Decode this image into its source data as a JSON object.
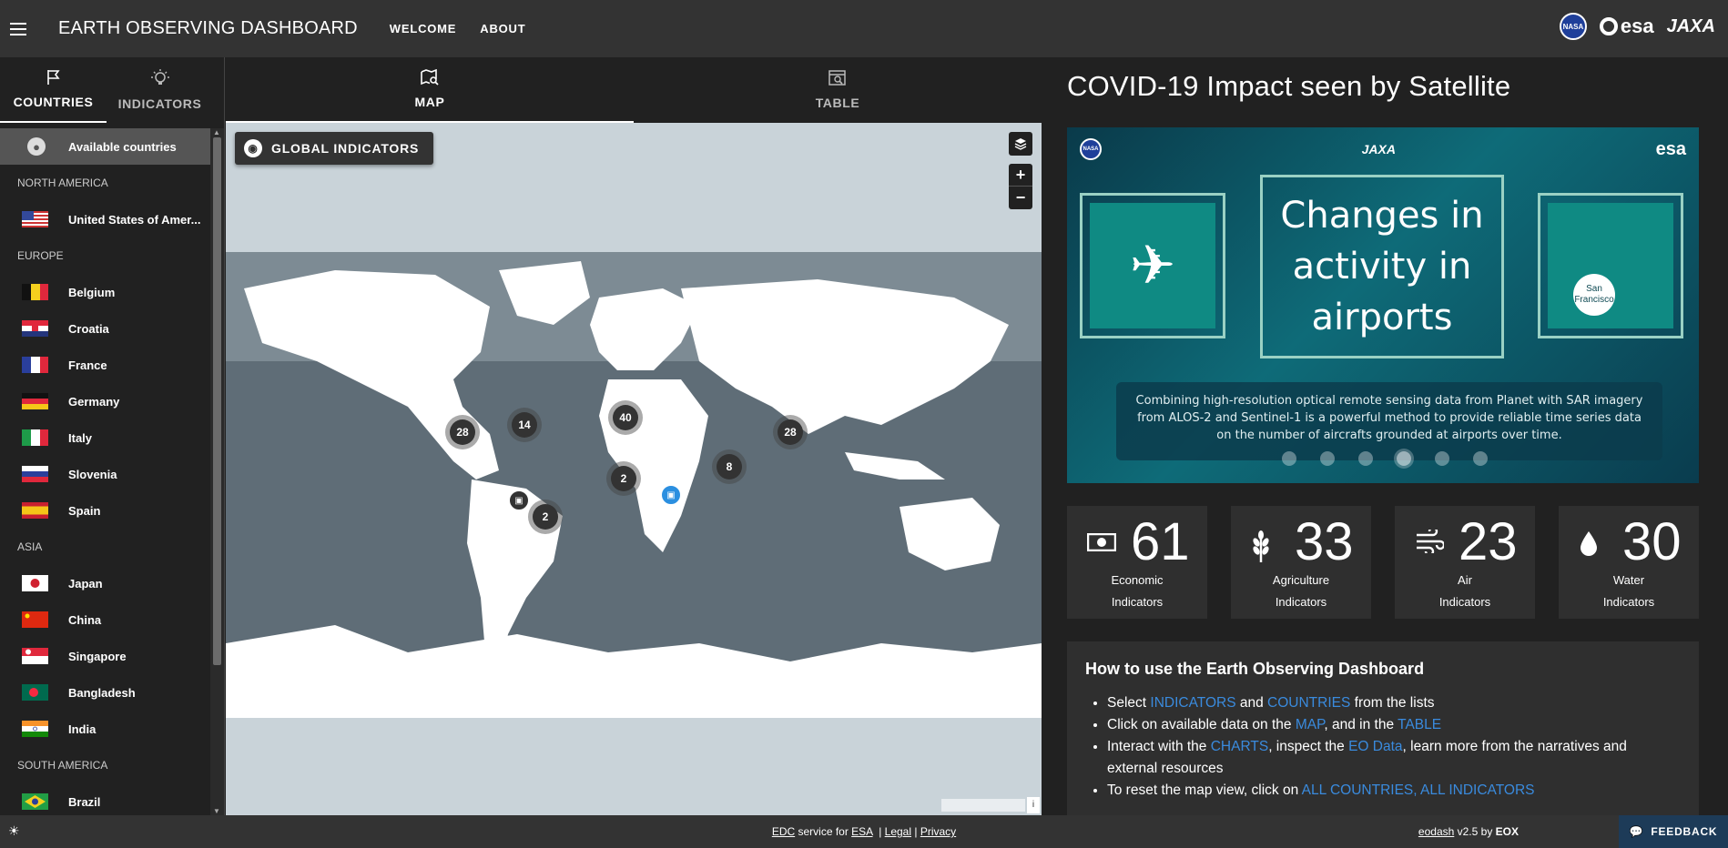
{
  "app": {
    "title": "EARTH OBSERVING DASHBOARD"
  },
  "topnav": [
    "WELCOME",
    "ABOUT"
  ],
  "logos": {
    "nasa": "NASA",
    "esa": "esa",
    "jaxa": "JAXA"
  },
  "sidebar": {
    "tabs": [
      {
        "label": "COUNTRIES",
        "icon": "flag-icon",
        "active": true
      },
      {
        "label": "INDICATORS",
        "icon": "lightbulb-icon",
        "active": false
      }
    ],
    "available": "Available countries",
    "regions": {
      "north_america": "NORTH AMERICA",
      "europe": "EUROPE",
      "asia": "ASIA",
      "south_america": "SOUTH AMERICA"
    },
    "countries": {
      "usa": "United States of Amer...",
      "belgium": "Belgium",
      "croatia": "Croatia",
      "france": "France",
      "germany": "Germany",
      "italy": "Italy",
      "slovenia": "Slovenia",
      "spain": "Spain",
      "japan": "Japan",
      "china": "China",
      "singapore": "Singapore",
      "bangladesh": "Bangladesh",
      "india": "India",
      "brazil": "Brazil"
    }
  },
  "center": {
    "tabs": [
      {
        "label": "MAP",
        "icon": "map-search-icon",
        "active": true
      },
      {
        "label": "TABLE",
        "icon": "table-search-icon",
        "active": false
      }
    ],
    "global_button": "GLOBAL INDICATORS",
    "zoom_in": "+",
    "zoom_out": "−",
    "info": "i",
    "clusters": [
      "28",
      "14",
      "40",
      "2",
      "8",
      "28",
      "2"
    ]
  },
  "right": {
    "title": "COVID-19 Impact seen by Satellite",
    "banner": {
      "headline": [
        "Changes in",
        "activity in",
        "airports"
      ],
      "description": "Combining high-resolution optical remote sensing data from Planet with SAR imagery from ALOS-2 and Sentinel-1 is a powerful method to provide reliable time series data on the number of aircrafts grounded at airports over time.",
      "city_label": "San Francisco",
      "logos": {
        "nasa": "NASA",
        "jaxa": "JAXA",
        "esa": "esa"
      }
    },
    "stats": [
      {
        "value": "61",
        "label1": "Economic",
        "label2": "Indicators",
        "icon": "money-icon"
      },
      {
        "value": "33",
        "label1": "Agriculture",
        "label2": "Indicators",
        "icon": "wheat-icon"
      },
      {
        "value": "23",
        "label1": "Air",
        "label2": "Indicators",
        "icon": "wind-icon"
      },
      {
        "value": "30",
        "label1": "Water",
        "label2": "Indicators",
        "icon": "water-drop-icon"
      }
    ],
    "howto": {
      "title": "How to use the Earth Observing Dashboard",
      "line1": {
        "a": "Select ",
        "b": "INDICATORS",
        "c": " and ",
        "d": "COUNTRIES",
        "e": " from the lists"
      },
      "line2": {
        "a": "Click on available data on the ",
        "b": "MAP",
        "c": ", and in the ",
        "d": "TABLE"
      },
      "line3": {
        "a": "Interact with the ",
        "b": "CHARTS",
        "c": ", inspect the ",
        "d": "EO Data",
        "e": ", learn more from the narratives and external resources"
      },
      "line4": {
        "a": "To reset the map view, click on ",
        "b": "ALL COUNTRIES, ALL INDICATORS"
      }
    }
  },
  "footer": {
    "edc": "EDC",
    "service_for": " service for ",
    "esa": "ESA",
    "sep1": "  | ",
    "legal": "Legal",
    "sep2": " | ",
    "privacy": "Privacy",
    "eodash": "eodash",
    "version": " v2.5 by ",
    "eox": "EOX",
    "feedback": "FEEDBACK"
  }
}
